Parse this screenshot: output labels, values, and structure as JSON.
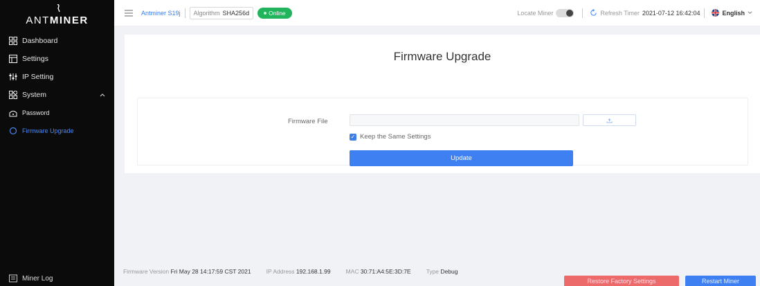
{
  "brand": {
    "logo_text_light": "ANT",
    "logo_text_bold": "MINER"
  },
  "sidebar": {
    "items": [
      {
        "label": "Dashboard",
        "icon": "dashboard-icon"
      },
      {
        "label": "Settings",
        "icon": "settings-icon"
      },
      {
        "label": "IP Setting",
        "icon": "ip-setting-icon"
      },
      {
        "label": "System",
        "icon": "system-icon"
      },
      {
        "label": "Password",
        "icon": "password-icon"
      },
      {
        "label": "Firmware Upgrade",
        "icon": "firmware-icon"
      }
    ],
    "bottom_label": "Miner Log"
  },
  "header": {
    "model": "Antminer S19j",
    "algorithm_label": "Algorithm",
    "algorithm_value": "SHA256d",
    "status": "Online",
    "locate_label": "Locate Miner",
    "refresh_label": "Refresh Timer",
    "refresh_value": "2021-07-12 16:42:04",
    "language": "English"
  },
  "main": {
    "title": "Firmware Upgrade",
    "firmware_file_label": "Firmware File",
    "keep_settings_label": "Keep the Same Settings",
    "update_label": "Update"
  },
  "footer": {
    "firmware_version_label": "Firmware Version",
    "firmware_version_value": "Fri May 28 14:17:59 CST 2021",
    "ip_label": "IP Address",
    "ip_value": "192.168.1.99",
    "mac_label": "MAC",
    "mac_value": "30:71:A4:5E:3D:7E",
    "type_label": "Type",
    "type_value": "Debug",
    "restore_label": "Restore Factory Settings",
    "restart_label": "Restart Miner"
  },
  "colors": {
    "accent": "#3e80f1",
    "online": "#21b45c",
    "danger": "#ec6a6a",
    "sidebar_bg": "#0b0b0b"
  }
}
